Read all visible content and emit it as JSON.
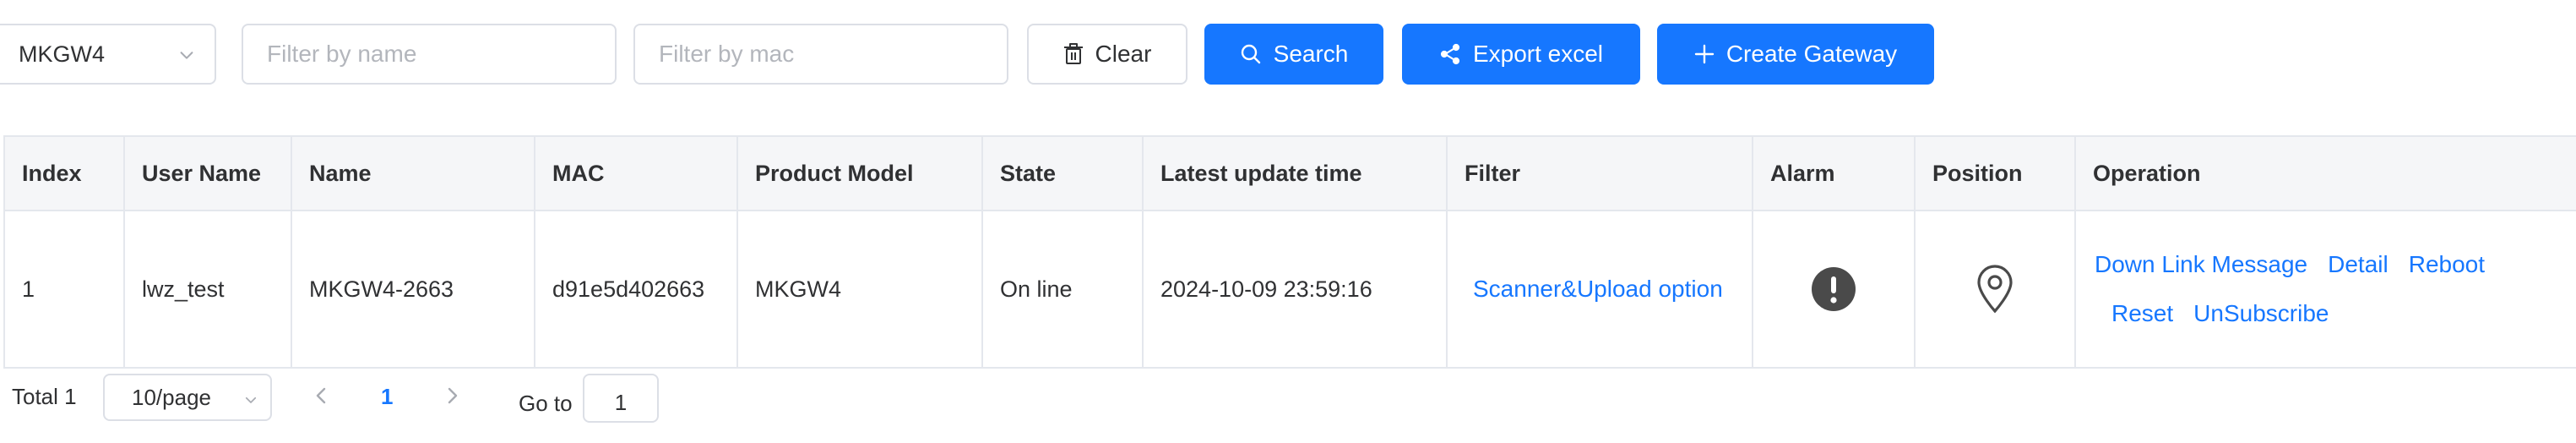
{
  "toolbar": {
    "model_select": {
      "value": "MKGW4"
    },
    "name_filter": {
      "placeholder": "Filter by name",
      "value": ""
    },
    "mac_filter": {
      "placeholder": "Filter by mac",
      "value": ""
    },
    "clear_label": "Clear",
    "search_label": "Search",
    "export_label": "Export excel",
    "create_label": "Create Gateway"
  },
  "table": {
    "columns": [
      "Index",
      "User Name",
      "Name",
      "MAC",
      "Product Model",
      "State",
      "Latest update time",
      "Filter",
      "Alarm",
      "Position",
      "Operation"
    ],
    "rows": [
      {
        "index": "1",
        "user_name": "lwz_test",
        "name": "MKGW4-2663",
        "mac": "d91e5d402663",
        "product_model": "MKGW4",
        "state": "On line",
        "latest_update_time": "2024-10-09 23:59:16",
        "filter": "Scanner&Upload option",
        "alarm_icon": "alert-circle-icon",
        "position_icon": "map-pin-icon",
        "operations": [
          "Down Link Message",
          "Detail",
          "Reboot",
          "Reset",
          "UnSubscribe"
        ]
      }
    ]
  },
  "pagination": {
    "total_label": "Total 1",
    "page_size": "10/page",
    "current_page": "1",
    "goto_label": "Go to",
    "goto_value": "1"
  },
  "colors": {
    "primary": "#1677ff",
    "header_bg": "#f5f6f8",
    "border": "#e4e7ed",
    "alarm_icon": "#4a4a4a"
  }
}
